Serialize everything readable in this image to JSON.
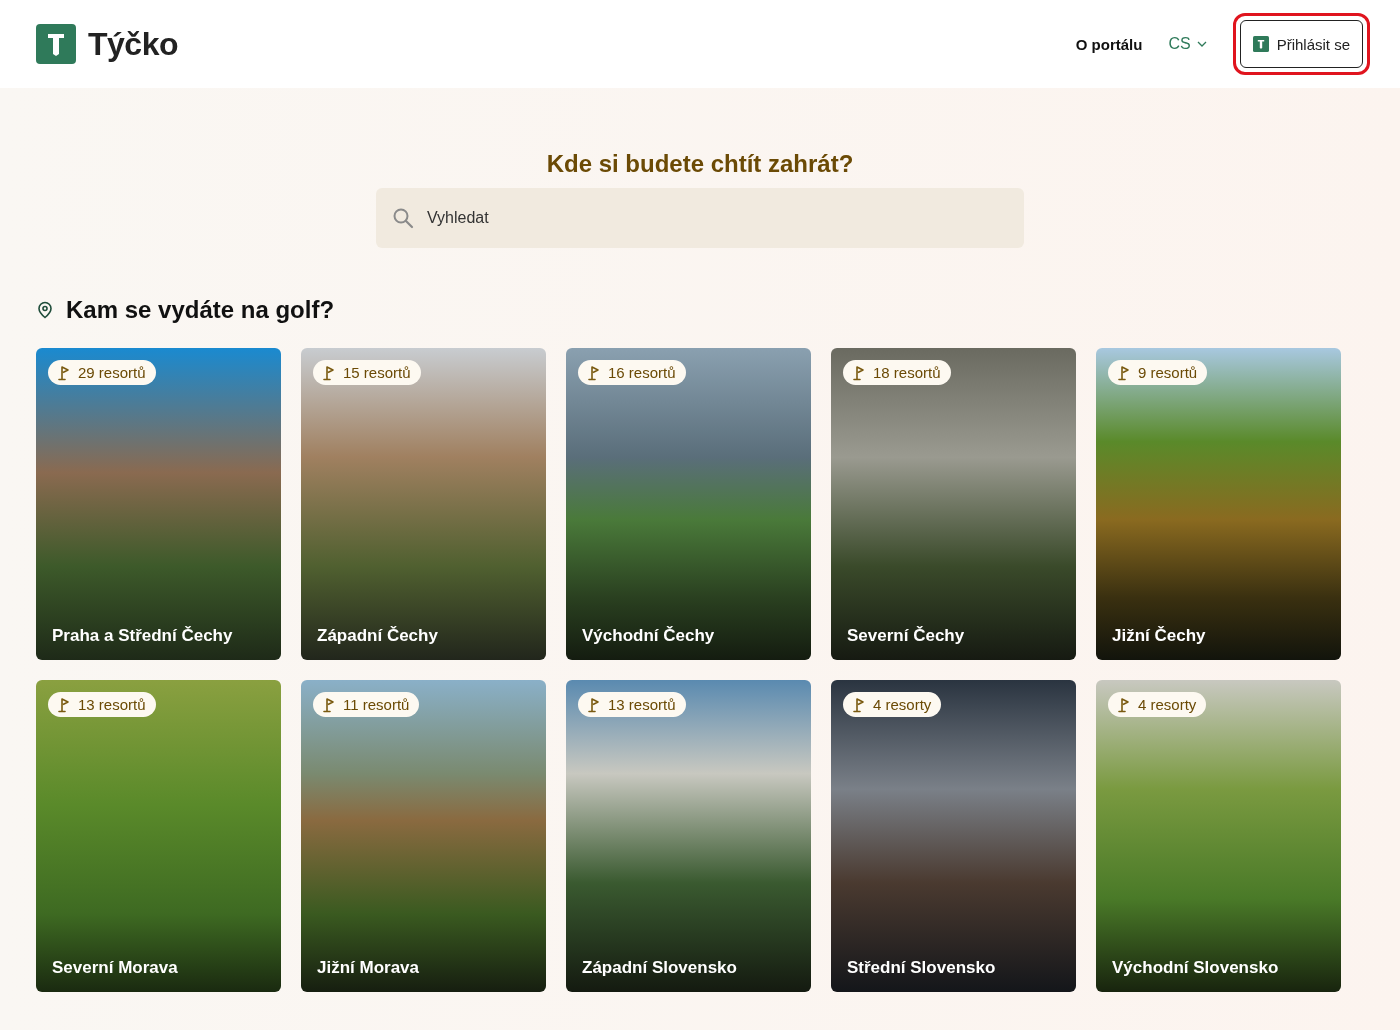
{
  "header": {
    "logo_text": "Týčko",
    "nav": [
      {
        "label": "O portálu"
      }
    ],
    "language": "CS",
    "login_button": "Přihlásit se",
    "login_highlighted": true
  },
  "search": {
    "heading": "Kde si budete chtít zahrát?",
    "placeholder": "Vyhledat"
  },
  "regions_heading": "Kam se vydáte na golf?",
  "regions": [
    {
      "name": "Praha a Střední Čechy",
      "count": "29 resortů"
    },
    {
      "name": "Západní Čechy",
      "count": "15 resortů"
    },
    {
      "name": "Východní Čechy",
      "count": "16 resortů"
    },
    {
      "name": "Severní Čechy",
      "count": "18 resortů"
    },
    {
      "name": "Jižní Čechy",
      "count": "9 resortů"
    },
    {
      "name": "Severní Morava",
      "count": "13 resortů"
    },
    {
      "name": "Jižní Morava",
      "count": "11 resortů"
    },
    {
      "name": "Západní Slovensko",
      "count": "13 resortů"
    },
    {
      "name": "Střední Slovensko",
      "count": "4 resorty"
    },
    {
      "name": "Východní Slovensko",
      "count": "4 resorty"
    }
  ]
}
